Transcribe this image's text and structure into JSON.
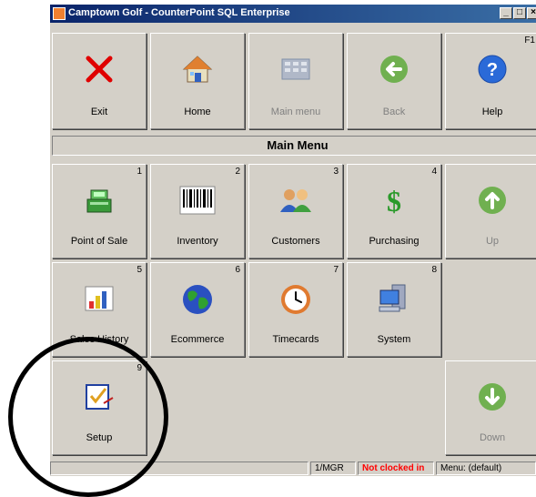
{
  "window": {
    "title": "Camptown Golf - CounterPoint SQL Enterprise"
  },
  "toolbar": {
    "exit": "Exit",
    "home": "Home",
    "main_menu": "Main menu",
    "back": "Back",
    "help": "Help",
    "help_key": "F1"
  },
  "header": {
    "title": "Main Menu"
  },
  "menu": {
    "items": [
      {
        "num": "1",
        "label": "Point of Sale"
      },
      {
        "num": "2",
        "label": "Inventory"
      },
      {
        "num": "3",
        "label": "Customers"
      },
      {
        "num": "4",
        "label": "Purchasing"
      },
      {
        "num": "5",
        "label": "Sales History"
      },
      {
        "num": "6",
        "label": "Ecommerce"
      },
      {
        "num": "7",
        "label": "Timecards"
      },
      {
        "num": "8",
        "label": "System"
      },
      {
        "num": "9",
        "label": "Setup"
      }
    ]
  },
  "nav": {
    "up": "Up",
    "down": "Down"
  },
  "status": {
    "user": "1/MGR",
    "clock": "Not clocked in",
    "menu": "Menu: (default)"
  },
  "colors": {
    "titlebar": "#0a246a",
    "not_clocked_in": "#ff0000",
    "disabled_text": "#808080"
  }
}
